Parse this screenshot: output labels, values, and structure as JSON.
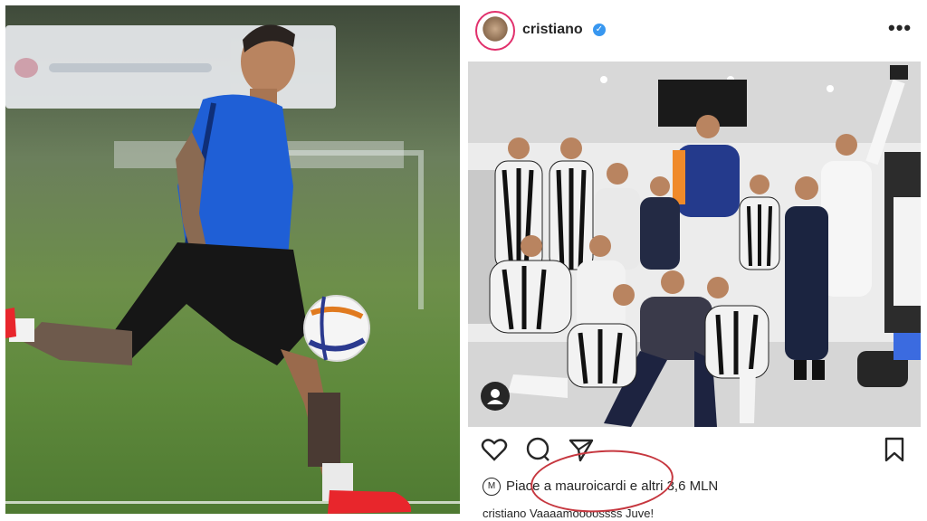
{
  "left_photo": {
    "alt": "player kicking ball on training pitch",
    "colors": {
      "shirt": "#1f5fd6",
      "shorts": "#161616",
      "boots": "#e8262c",
      "grass": "#5f8a3c"
    }
  },
  "post": {
    "username": "cristiano",
    "verified_icon": "verified-badge-icon",
    "more_icon": "more-options-icon",
    "more_glyph": "•••",
    "likes_brand": "M",
    "likes_text": "Piace a mauroicardi e altri 3,6 MLN",
    "caption_text": "cristiano Vaaaamoooossss Juve!",
    "action_icons": [
      "heart-icon",
      "comment-icon",
      "share-icon",
      "bookmark-icon"
    ],
    "annotation_color": "#c6373f"
  }
}
